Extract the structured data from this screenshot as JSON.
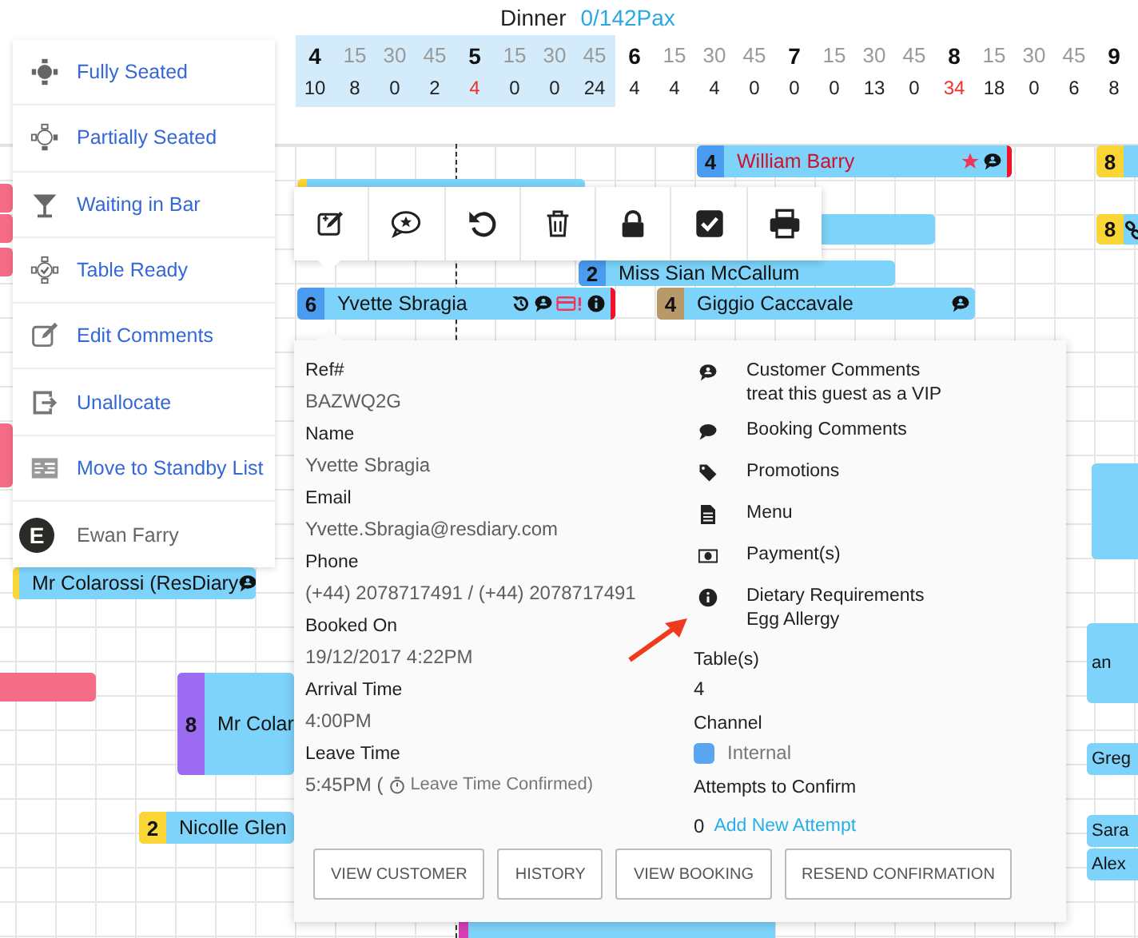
{
  "header": {
    "service": "Dinner",
    "pax": "0/142Pax"
  },
  "timeline": [
    {
      "label": "4",
      "hour": true,
      "count": "10",
      "over": false,
      "highlighted": true
    },
    {
      "label": "15",
      "hour": false,
      "count": "8",
      "over": false,
      "highlighted": true
    },
    {
      "label": "30",
      "hour": false,
      "count": "0",
      "over": false,
      "highlighted": true
    },
    {
      "label": "45",
      "hour": false,
      "count": "2",
      "over": false,
      "highlighted": true
    },
    {
      "label": "5",
      "hour": true,
      "count": "4",
      "over": true,
      "highlighted": true
    },
    {
      "label": "15",
      "hour": false,
      "count": "0",
      "over": false,
      "highlighted": true
    },
    {
      "label": "30",
      "hour": false,
      "count": "0",
      "over": false,
      "highlighted": true
    },
    {
      "label": "45",
      "hour": false,
      "count": "24",
      "over": false,
      "highlighted": true
    },
    {
      "label": "6",
      "hour": true,
      "count": "4",
      "over": false,
      "highlighted": false
    },
    {
      "label": "15",
      "hour": false,
      "count": "4",
      "over": false,
      "highlighted": false
    },
    {
      "label": "30",
      "hour": false,
      "count": "4",
      "over": false,
      "highlighted": false
    },
    {
      "label": "45",
      "hour": false,
      "count": "0",
      "over": false,
      "highlighted": false
    },
    {
      "label": "7",
      "hour": true,
      "count": "0",
      "over": false,
      "highlighted": false
    },
    {
      "label": "15",
      "hour": false,
      "count": "0",
      "over": false,
      "highlighted": false
    },
    {
      "label": "30",
      "hour": false,
      "count": "13",
      "over": false,
      "highlighted": false
    },
    {
      "label": "45",
      "hour": false,
      "count": "0",
      "over": false,
      "highlighted": false
    },
    {
      "label": "8",
      "hour": true,
      "count": "34",
      "over": true,
      "highlighted": false
    },
    {
      "label": "15",
      "hour": false,
      "count": "18",
      "over": false,
      "highlighted": false
    },
    {
      "label": "30",
      "hour": false,
      "count": "0",
      "over": false,
      "highlighted": false
    },
    {
      "label": "45",
      "hour": false,
      "count": "6",
      "over": false,
      "highlighted": false
    },
    {
      "label": "9",
      "hour": true,
      "count": "8",
      "over": false,
      "highlighted": false
    }
  ],
  "bookings": [
    {
      "covers": "4",
      "name": "William Barry",
      "color": "#4a9cf0",
      "alert_name": true,
      "vip": true,
      "comment": true,
      "flag": true
    },
    {
      "covers": "8",
      "color": "#f9d635"
    },
    {
      "covers": "2",
      "name": "Miss Sian McCallum",
      "color": "#4a9cf0",
      "alert_name": false
    },
    {
      "covers": "8",
      "color": "#f9d635",
      "linked": true
    },
    {
      "covers": "6",
      "name": "Yvette Sbragia",
      "color": "#4a9cf0",
      "history": true,
      "comment": true,
      "payment_issue": true,
      "info": true,
      "flag": true
    },
    {
      "covers": "4",
      "name": "Giggio Caccavale",
      "color": "#b89a6a",
      "comment": true
    },
    {
      "name": "Mr Colarossi (ResDiary",
      "color": "#f9d635",
      "comment": true
    },
    {
      "covers": "8",
      "name": "Mr Colar",
      "color": "#9b6cf2"
    },
    {
      "covers": "2",
      "name": "Nicolle Glen",
      "color": "#f9d635"
    },
    {
      "name": "an"
    },
    {
      "name": "Greg"
    },
    {
      "name": "Sara"
    },
    {
      "name": "Alex"
    }
  ],
  "menu": [
    {
      "kind": "fully-seated",
      "label": "Fully Seated"
    },
    {
      "kind": "partially-seated",
      "label": "Partially Seated"
    },
    {
      "kind": "waiting-bar",
      "label": "Waiting in Bar"
    },
    {
      "kind": "table-ready",
      "label": "Table Ready"
    },
    {
      "kind": "edit-comments",
      "label": "Edit Comments"
    },
    {
      "kind": "unallocate",
      "label": "Unallocate"
    },
    {
      "kind": "standby",
      "label": "Move to Standby List"
    },
    {
      "kind": "user",
      "initial": "E",
      "label": "Ewan Farry"
    }
  ],
  "toolbar": [
    {
      "kind": "edit"
    },
    {
      "kind": "vip-comment"
    },
    {
      "kind": "undo"
    },
    {
      "kind": "delete"
    },
    {
      "kind": "lock"
    },
    {
      "kind": "check"
    },
    {
      "kind": "print"
    }
  ],
  "details": {
    "fields": [
      {
        "label": "Ref#",
        "value": "BAZWQ2G"
      },
      {
        "label": "Name",
        "value": "Yvette Sbragia"
      },
      {
        "label": "Email",
        "value": "Yvette.Sbragia@resdiary.com"
      },
      {
        "label": "Phone",
        "value": "(+44) 2078717491 / (+44) 2078717491"
      },
      {
        "label": "Booked On",
        "value": "19/12/2017 4:22PM"
      },
      {
        "label": "Arrival Time",
        "value": "4:00PM"
      },
      {
        "label": "Leave Time",
        "value": "5:45PM (",
        "note": "Leave Time Confirmed)"
      }
    ],
    "info": [
      {
        "kind": "customer-comments",
        "title": "Customer Comments",
        "text": "treat this guest as a VIP"
      },
      {
        "kind": "booking-comments",
        "title": "Booking Comments"
      },
      {
        "kind": "promotions",
        "title": "Promotions"
      },
      {
        "kind": "menu",
        "title": "Menu"
      },
      {
        "kind": "payments",
        "title": "Payment(s)"
      },
      {
        "kind": "dietary",
        "title": "Dietary Requirements",
        "text": "Egg Allergy"
      }
    ],
    "tables": {
      "label": "Table(s)",
      "value": "4"
    },
    "channel": {
      "label": "Channel",
      "value": "Internal",
      "color": "#5aa5f0"
    },
    "attempts": {
      "label": "Attempts to Confirm",
      "value": "0",
      "link": "Add New Attempt"
    },
    "buttons": [
      "VIEW CUSTOMER",
      "HISTORY",
      "VIEW BOOKING",
      "RESEND CONFIRMATION"
    ]
  }
}
